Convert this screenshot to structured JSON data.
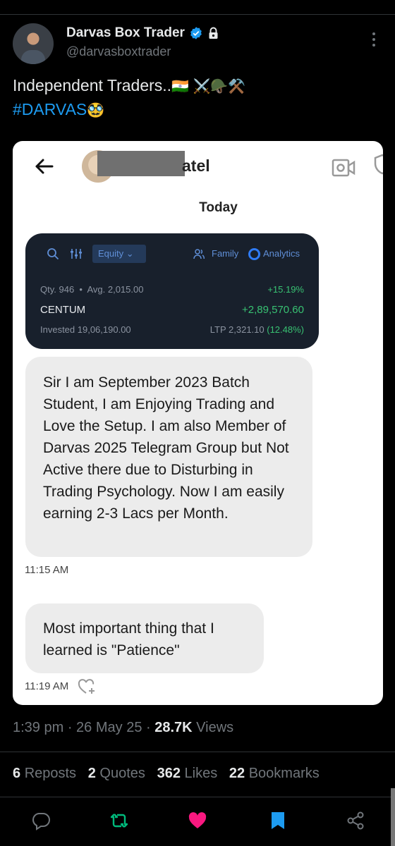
{
  "tweet": {
    "author_name": "Darvas Box Trader",
    "author_handle": "@darvasboxtrader",
    "text_line1": "Independent Traders..",
    "text_line1_emoji": "🇮🇳 ⚔️🪖⚒️",
    "hashtag": "#DARVAS",
    "hashtag_emoji": "🥸",
    "time": "1:39 pm",
    "date": "26 May 25",
    "views_count": "28.7K",
    "views_label": "Views",
    "reposts_count": "6",
    "reposts_label": "Reposts",
    "quotes_count": "2",
    "quotes_label": "Quotes",
    "likes_count": "362",
    "likes_label": "Likes",
    "bookmarks_count": "22",
    "bookmarks_label": "Bookmarks"
  },
  "chat": {
    "contact_name_visible": "atel",
    "day_label": "Today",
    "portfolio": {
      "filter_label": "Equity",
      "family_label": "Family",
      "analytics_label": "Analytics",
      "qty": "Qty. 946",
      "avg": "Avg. 2,015.00",
      "pct_change": "+15.19%",
      "symbol": "CENTUM",
      "pnl": "+2,89,570.60",
      "invested": "Invested 19,06,190.00",
      "ltp": "LTP 2,321.10",
      "ltp_change": "(12.48%)"
    },
    "message1": "Sir I am September 2023 Batch Student, I am Enjoying Trading and Love the Setup. I am also Member of Darvas 2025 Telegram Group but Not Active there due to Disturbing in Trading Psychology. Now I am easily earning 2-3 Lacs per Month.",
    "message1_time": "11:15 AM",
    "message2": "Most important thing  that I learned is \"Patience\"",
    "message2_time": "11:19 AM"
  },
  "colors": {
    "background": "#000000",
    "accent_blue": "#1d9bf0",
    "repost_green": "#00ba7c",
    "like_pink": "#f91880"
  }
}
